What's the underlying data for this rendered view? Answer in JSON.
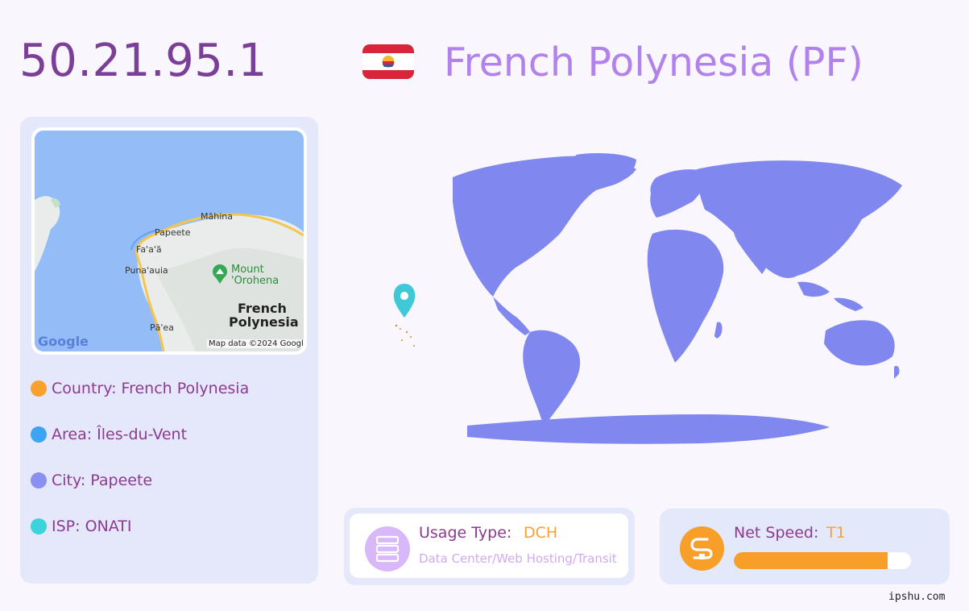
{
  "header": {
    "ip": "50.21.95.1",
    "country_title": "French Polynesia (PF)",
    "flag_icon": "french-polynesia-flag"
  },
  "map": {
    "labels": {
      "mahina": "Māhina",
      "papeete": "Papeete",
      "faaa": "Fa'a'ā",
      "punaauia": "Puna'auia",
      "mount": "Mount",
      "orohena": "'Orohena",
      "french": "French",
      "polynesia": "Polynesia",
      "paea": "Pā'ea",
      "google": "Google",
      "attribution": "Map data ©2024 Google"
    }
  },
  "info": {
    "country": "Country: French Polynesia",
    "area": "Area: Îles-du-Vent",
    "city": "City: Papeete",
    "isp": "ISP: ONATI",
    "colors": {
      "country": "#f8a12d",
      "area": "#3ca4f2",
      "city": "#8a8ff2",
      "isp": "#3cd3dd"
    }
  },
  "usage": {
    "label": "Usage Type:",
    "value": "DCH",
    "description": "Data Center/Web Hosting/Transit",
    "icon": "server-icon"
  },
  "speed": {
    "label": "Net Speed:",
    "value": "T1",
    "progress": 0.87,
    "icon": "speed-icon"
  },
  "world_map": {
    "marker_icon": "location-pin-icon",
    "land_color": "#8087ee",
    "marker_color": "#40c8d8"
  },
  "watermark": "ipshu.com"
}
